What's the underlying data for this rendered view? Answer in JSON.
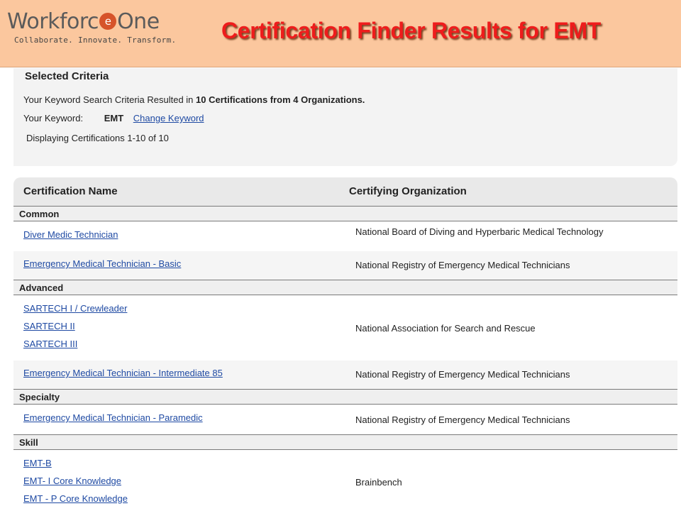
{
  "header": {
    "logo_word_left": "Workforc",
    "logo_e_glyph": "e",
    "logo_word_right": "One",
    "logo_tagline": "Collaborate. Innovate. Transform.",
    "title": "Certification Finder Results for EMT"
  },
  "criteria": {
    "heading": "Selected Criteria",
    "summary_prefix": "Your Keyword Search Criteria Resulted in ",
    "summary_bold": "10 Certifications from 4 Organizations.",
    "keyword_label": "Your Keyword:",
    "keyword_value": "EMT",
    "change_keyword_link": "Change Keyword",
    "displaying": "Displaying Certifications 1-10 of 10"
  },
  "table": {
    "col_name": "Certification Name",
    "col_org": "Certifying Organization",
    "categories": [
      "Common",
      "Advanced",
      "Specialty",
      "Skill"
    ],
    "rows": [
      {
        "certs": [
          "Diver Medic Technician"
        ],
        "org": "National Board of Diving and Hyperbaric Medical Technology"
      },
      {
        "certs": [
          "Emergency Medical Technician - Basic"
        ],
        "org": "National Registry of Emergency Medical Technicians"
      },
      {
        "certs": [
          "SARTECH I / Crewleader",
          "SARTECH II",
          "SARTECH III"
        ],
        "org": "National Association for Search and Rescue"
      },
      {
        "certs": [
          "Emergency Medical Technician - Intermediate 85"
        ],
        "org": "National Registry of Emergency Medical Technicians"
      },
      {
        "certs": [
          "Emergency Medical Technician - Paramedic"
        ],
        "org": "National Registry of Emergency Medical Technicians"
      },
      {
        "certs": [
          "EMT-B",
          "EMT- I Core Knowledge",
          "EMT - P Core Knowledge"
        ],
        "org": "Brainbench"
      }
    ]
  }
}
